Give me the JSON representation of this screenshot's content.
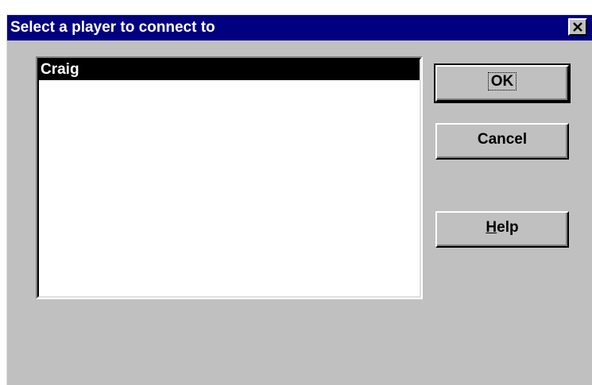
{
  "dialog": {
    "title": "Select a player to connect to",
    "close_icon": "close-icon"
  },
  "players": {
    "items": [
      {
        "label": "Craig",
        "selected": true
      }
    ]
  },
  "buttons": {
    "ok_label": "OK",
    "cancel_label": "Cancel",
    "help_mnemonic": "H",
    "help_rest": "elp"
  },
  "colors": {
    "titlebar": "#000080",
    "face": "#c0c0c0",
    "selection": "#000000"
  }
}
